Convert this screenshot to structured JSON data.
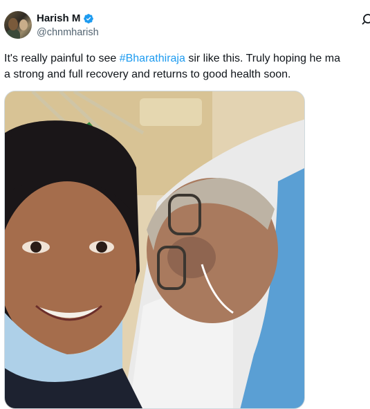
{
  "author": {
    "display_name": "Harish M",
    "handle": "@chnmharish",
    "verified": true,
    "avatar_icon": "profile-avatar"
  },
  "tweet": {
    "text_before": "It's really painful to see ",
    "hashtag": "#Bharathiraja",
    "text_line1_after": " sir like this. Truly hoping he ma",
    "text_line2": "a strong and full recovery and returns to good health soon."
  },
  "icons": {
    "verified": "verified-badge-icon",
    "grok": "grok-icon"
  },
  "colors": {
    "hashtag": "#1d9bf0",
    "verified": "#1d9bf0",
    "handle": "#536471",
    "text": "#0f1419"
  }
}
